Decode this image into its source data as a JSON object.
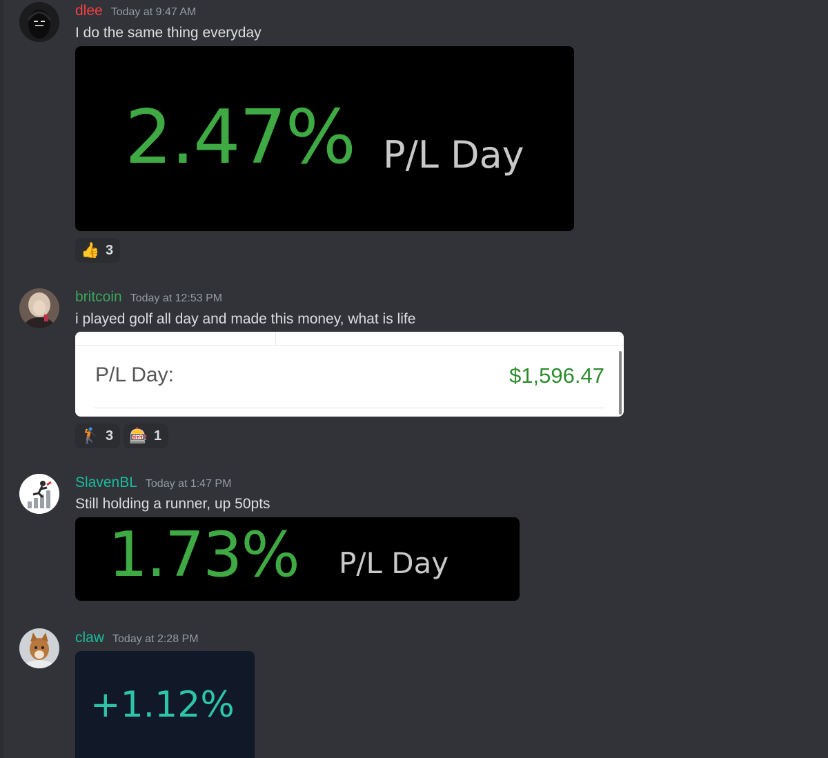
{
  "messages": [
    {
      "username": "dlee",
      "username_color": "#f23f43",
      "timestamp": "Today at 9:47 AM",
      "text": "I do the same thing everyday",
      "embed": {
        "percent": "2.47%",
        "label": "P/L Day",
        "background": "#000000"
      },
      "reactions": [
        {
          "emoji": "👍",
          "count": "3"
        }
      ]
    },
    {
      "username": "britcoin",
      "username_color": "#3ba55c",
      "timestamp": "Today at 12:53 PM",
      "text": "i played golf all day and made this money, what is life",
      "embed": {
        "label": "P/L Day:",
        "value": "$1,596.47",
        "background": "#ffffff"
      },
      "reactions": [
        {
          "emoji": "🏌",
          "count": "3"
        },
        {
          "emoji": "🎰",
          "count": "1"
        }
      ]
    },
    {
      "username": "SlavenBL",
      "username_color": "#1abc9c",
      "timestamp": "Today at 1:47 PM",
      "text": "Still holding a runner, up 50pts",
      "embed": {
        "percent": "1.73%",
        "label": "P/L Day",
        "background": "#000000"
      }
    },
    {
      "username": "claw",
      "username_color": "#1abc9c",
      "timestamp": "Today at 2:28 PM",
      "embed": {
        "percent": "+1.12%",
        "background": "#111827",
        "value_color": "#2ec4a6"
      }
    }
  ]
}
